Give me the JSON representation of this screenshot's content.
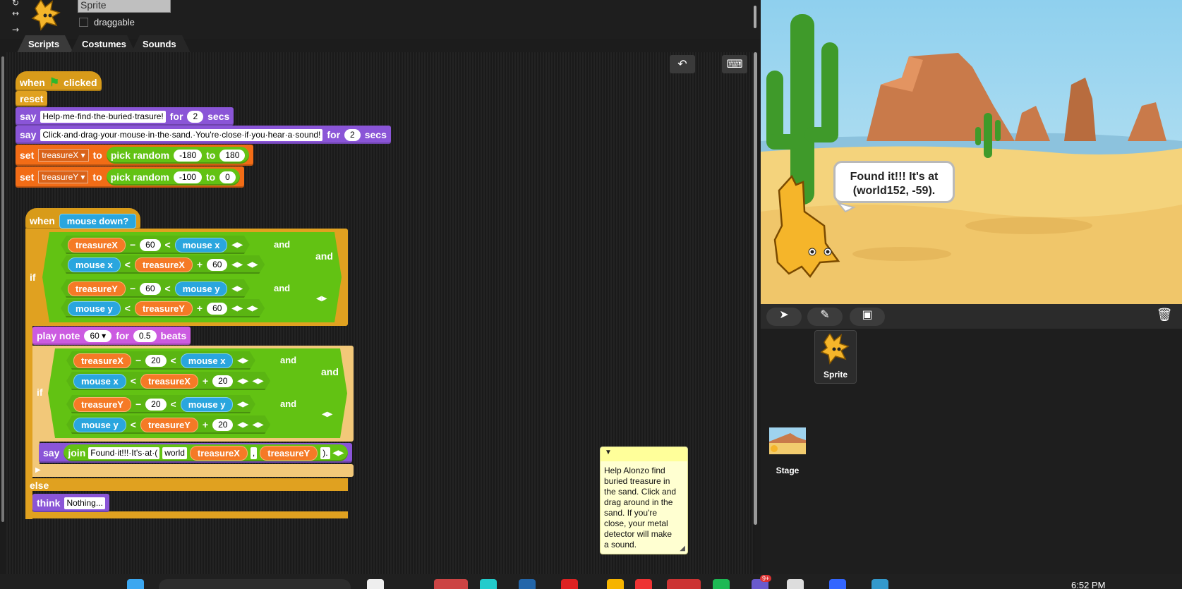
{
  "sprite": {
    "name": "Sprite",
    "draggable_label": "draggable"
  },
  "tabs": [
    {
      "label": "Scripts"
    },
    {
      "label": "Costumes"
    },
    {
      "label": "Sounds"
    }
  ],
  "script1": {
    "when": "when",
    "clicked": "clicked",
    "reset": "reset",
    "say1": {
      "kw": "say",
      "text": "Help·me·find·the·buried·trasure!",
      "for": "for",
      "n": "2",
      "secs": "secs"
    },
    "say2": {
      "kw": "say",
      "text": "Click·and·drag·your·mouse·in·the·sand.·You're·close·if·you·hear·a·sound!",
      "for": "for",
      "n": "2",
      "secs": "secs"
    },
    "set1": {
      "kw": "set",
      "var": "treasureX",
      "to": "to",
      "pick": "pick random",
      "a": "-180",
      "to2": "to",
      "b": "180"
    },
    "set2": {
      "kw": "set",
      "var": "treasureY",
      "to": "to",
      "pick": "pick random",
      "a": "-100",
      "to2": "to",
      "b": "0"
    }
  },
  "script2": {
    "when": "when",
    "event": "mouse down?",
    "if": "if",
    "and": "and",
    "else": "else",
    "var_x": "treasureX",
    "var_y": "treasureY",
    "mouse_x": "mouse x",
    "mouse_y": "mouse y",
    "minus": "−",
    "plus": "+",
    "lt": "<",
    "n60": "60",
    "n20": "20",
    "play": {
      "kw": "play note",
      "note": "60",
      "for": "for",
      "beats_n": "0.5",
      "beats": "beats"
    },
    "say": {
      "kw": "say",
      "join": "join",
      "t1": "Found·it!!!·It's·at·(",
      "t2": "world",
      "t3": ",",
      "t4": ")."
    },
    "think": {
      "kw": "think",
      "text": "Nothing..."
    }
  },
  "comment": {
    "text": "Help Alonzo find\nburied treasure in\nthe sand. Click and\ndrag around in the\nsand. If you're\nclose, your metal\ndetector will make\na sound."
  },
  "stage": {
    "bubble_line1": "Found it!!! It's at",
    "bubble_line2": "(world152, -59)."
  },
  "corral": {
    "sprite_label": "Sprite",
    "stage_label": "Stage"
  },
  "taskbar": {
    "clock": "6:52 PM",
    "badge": "9+"
  }
}
